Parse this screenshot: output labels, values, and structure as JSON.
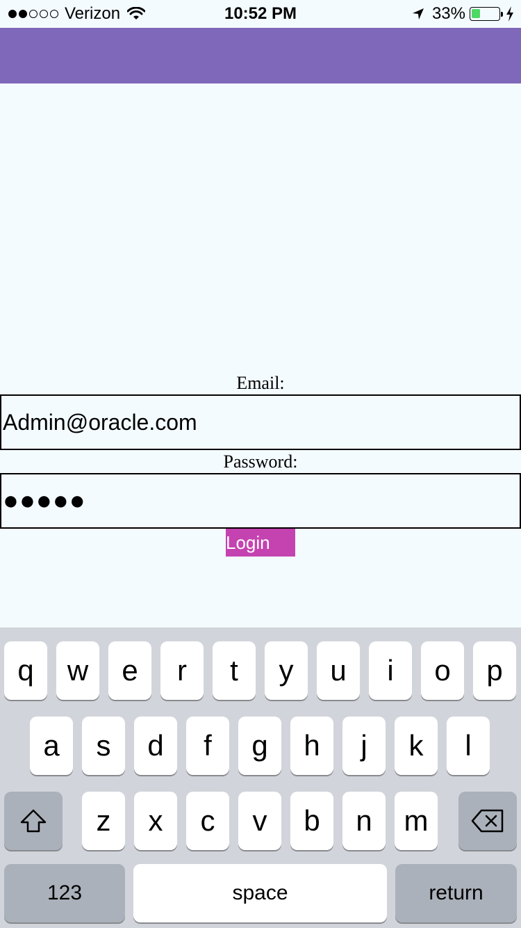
{
  "status_bar": {
    "carrier": "Verizon",
    "time": "10:52 PM",
    "battery_percent": "33%",
    "battery_level": 0.33,
    "signal_bars_filled": 2,
    "signal_bars_total": 5,
    "battery_color": "#4cd964"
  },
  "header": {
    "color": "#7f67ba"
  },
  "form": {
    "email_label": "Email:",
    "email_value": "Admin@oracle.com",
    "password_label": "Password:",
    "password_value": "●●●●●",
    "login_label": "Login",
    "login_color": "#c443b0"
  },
  "keyboard": {
    "row1": [
      "q",
      "w",
      "e",
      "r",
      "t",
      "y",
      "u",
      "i",
      "o",
      "p"
    ],
    "row2": [
      "a",
      "s",
      "d",
      "f",
      "g",
      "h",
      "j",
      "k",
      "l"
    ],
    "row3": [
      "z",
      "x",
      "c",
      "v",
      "b",
      "n",
      "m"
    ],
    "shift_icon": "shift-icon",
    "delete_icon": "backspace-icon",
    "numbers_label": "123",
    "space_label": "space",
    "return_label": "return"
  }
}
